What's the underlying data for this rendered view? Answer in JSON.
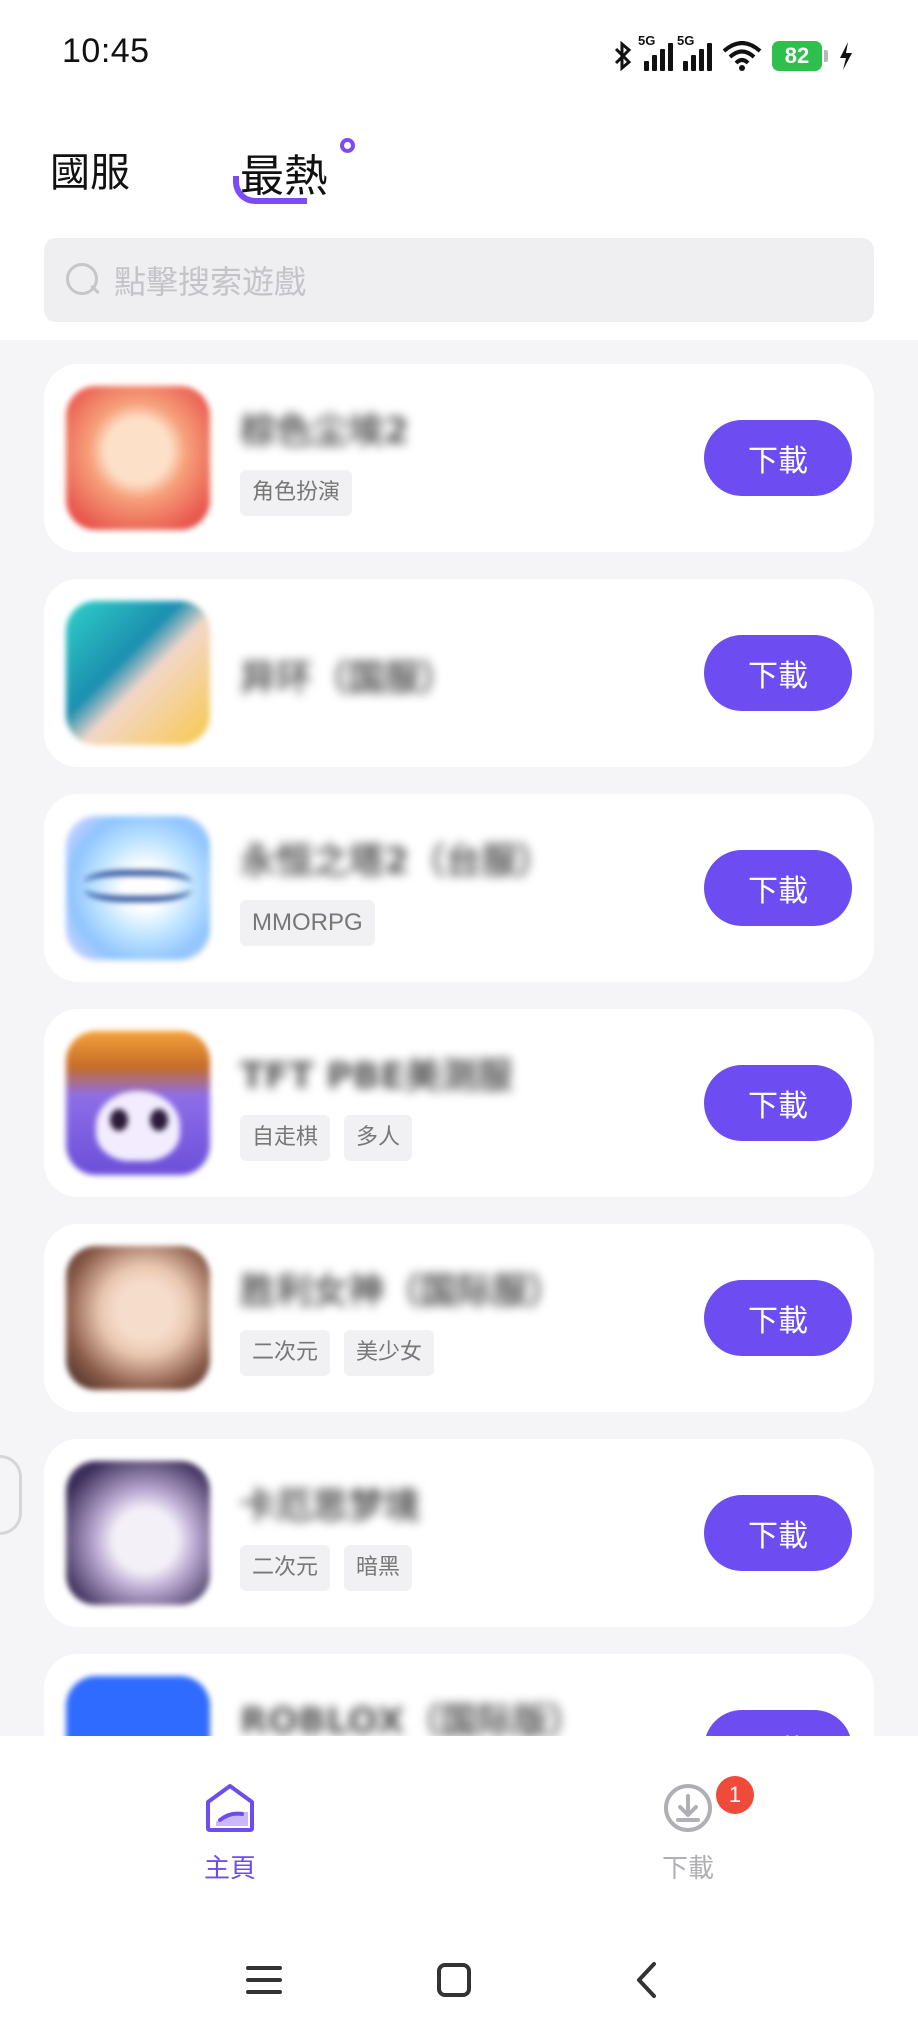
{
  "status_bar": {
    "time": "10:45",
    "network_1": "5G",
    "network_2": "5G",
    "battery": "82"
  },
  "tabs": [
    {
      "label": "國服"
    },
    {
      "label": "最熱"
    }
  ],
  "search": {
    "placeholder": "點擊搜索遊戲"
  },
  "games": [
    {
      "name": "棕色尘埃2",
      "tags": [
        "角色扮演"
      ],
      "button": "下載",
      "icon_colors": [
        "#f6a07a",
        "#e8524a"
      ]
    },
    {
      "name": "异环（国服）",
      "tags": [],
      "button": "下載",
      "icon_colors": [
        "#2fd0c8",
        "#f7c84a"
      ]
    },
    {
      "name": "永恒之塔2（台服）",
      "tags": [
        "MMORPG"
      ],
      "button": "下載",
      "icon_colors": [
        "#bfe4ff",
        "#3a7fe0"
      ]
    },
    {
      "name": "TFT PBE美测服",
      "tags": [
        "自走棋",
        "多人"
      ],
      "button": "下載",
      "icon_colors": [
        "#f5a13a",
        "#6b4fd8"
      ]
    },
    {
      "name": "胜利女神（国际服）",
      "tags": [
        "二次元",
        "美少女"
      ],
      "button": "下載",
      "icon_colors": [
        "#e9c7b0",
        "#a23a2a"
      ]
    },
    {
      "name": "卡厄思梦境",
      "tags": [
        "二次元",
        "暗黑"
      ],
      "button": "下載",
      "icon_colors": [
        "#3b2e5a",
        "#e9e4f2"
      ]
    },
    {
      "name": "ROBLOX（国际版）",
      "tags": [],
      "button": "下載",
      "icon_colors": [
        "#2f6bff",
        "#2f6bff"
      ]
    }
  ],
  "bottom_nav": {
    "home_label": "主頁",
    "download_label": "下載",
    "download_badge": "1"
  },
  "colors": {
    "accent": "#6d4cf2",
    "badge": "#f04a3a",
    "battery": "#2fbf4c"
  }
}
